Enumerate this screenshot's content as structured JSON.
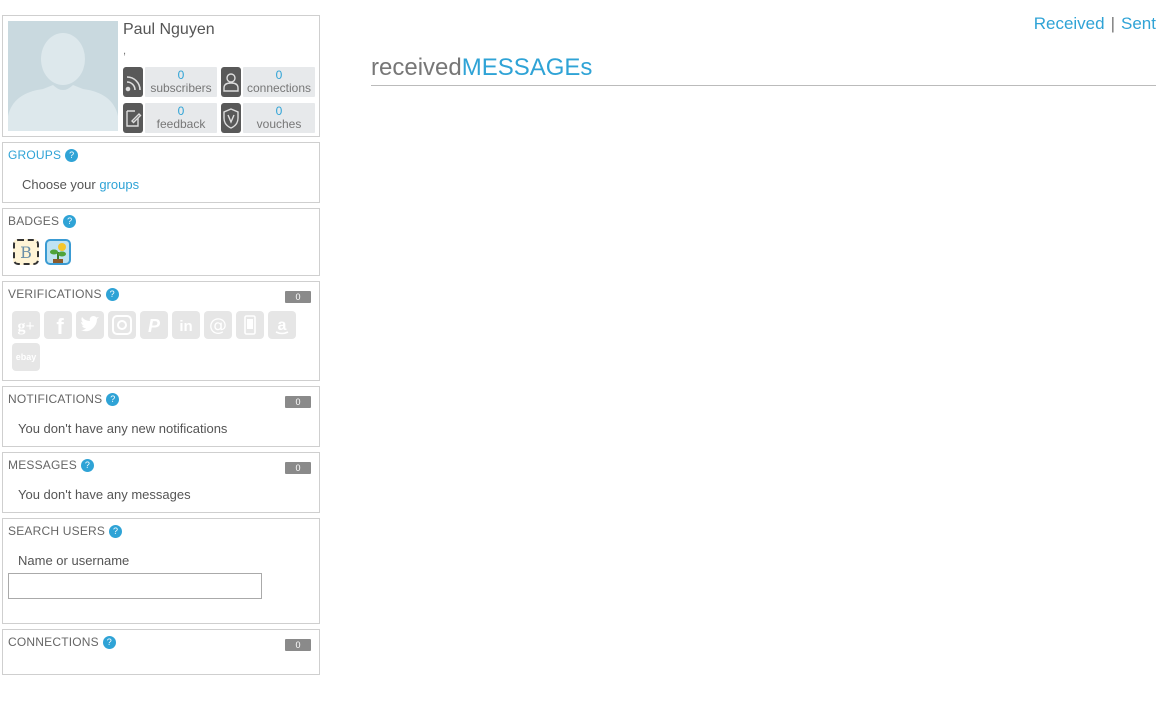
{
  "profile": {
    "name": "Paul Nguyen",
    "sub": ",",
    "stats": [
      {
        "value": "0",
        "label": "subscribers",
        "icon": "rss-icon"
      },
      {
        "value": "0",
        "label": "connections",
        "icon": "user-icon"
      },
      {
        "value": "0",
        "label": "feedback",
        "icon": "edit-icon"
      },
      {
        "value": "0",
        "label": "vouches",
        "icon": "shield-v-icon"
      }
    ]
  },
  "groups": {
    "title": "GROUPS",
    "text": "Choose your ",
    "link": "groups"
  },
  "badges": {
    "title": "BADGES"
  },
  "verifications": {
    "title": "VERIFICATIONS",
    "count": "0",
    "icons": [
      "google-plus-icon",
      "facebook-icon",
      "twitter-icon",
      "instagram-icon",
      "paypal-icon",
      "linkedin-icon",
      "email-icon",
      "phone-icon",
      "amazon-icon",
      "ebay-icon"
    ],
    "ebay_label": "ebay"
  },
  "notifications": {
    "title": "NOTIFICATIONS",
    "count": "0",
    "text": "You don't have any new notifications"
  },
  "messages": {
    "title": "MESSAGES",
    "count": "0",
    "text": "You don't have any messages"
  },
  "search": {
    "title": "SEARCH USERS",
    "label": "Name or username",
    "value": ""
  },
  "connections": {
    "title": "CONNECTIONS",
    "count": "0"
  },
  "help_glyph": "?",
  "topnav": {
    "received": "Received",
    "separator": "|",
    "sent": "Sent"
  },
  "heading": {
    "prefix": "received",
    "main": "MESSAGEs"
  },
  "colors": {
    "accent": "#2fa3d6",
    "icon_dark": "#595959",
    "badge_gray": "#8a8a8a"
  }
}
